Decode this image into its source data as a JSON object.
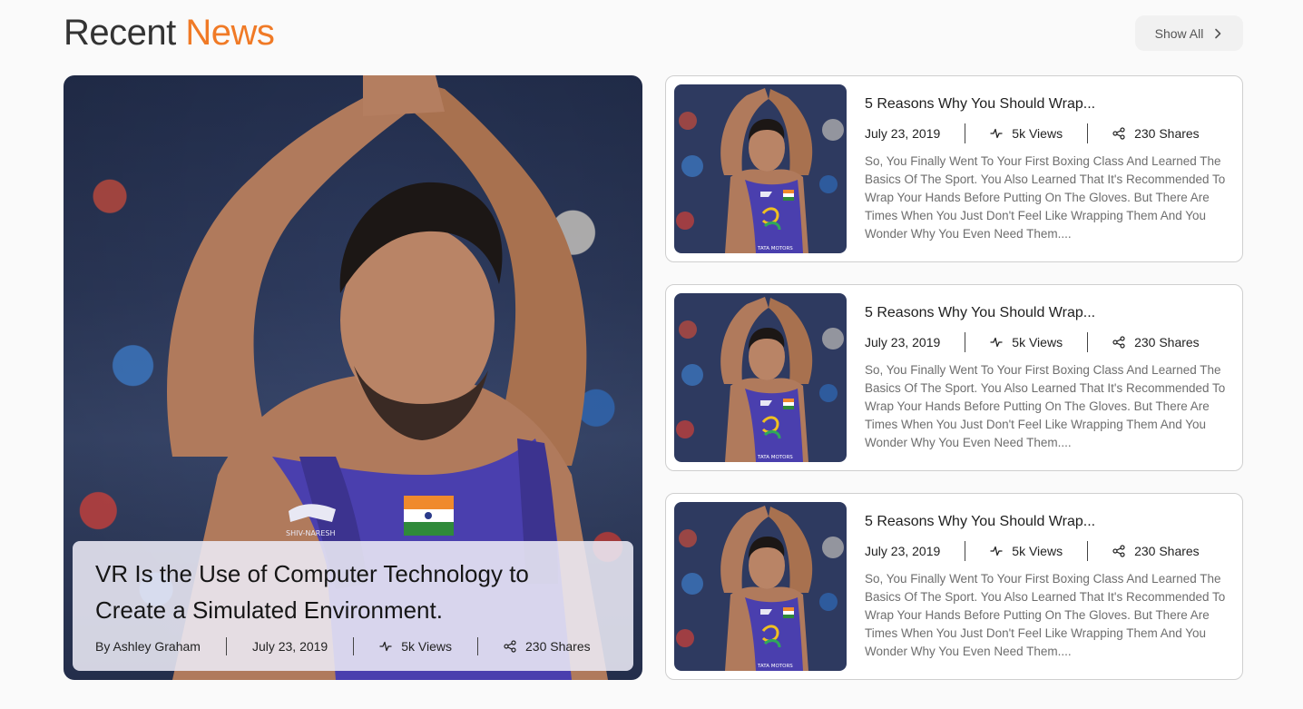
{
  "header": {
    "title_prefix": "Recent",
    "title_accent": "News",
    "accent_color": "#f07a26",
    "show_all_label": "Show All"
  },
  "featured": {
    "title": "VR Is the Use of Computer Technology to Create a Simulated Environment.",
    "author": "By Ashley Graham",
    "date": "July 23, 2019",
    "views": "5k Views",
    "shares": "230 Shares",
    "singlet_text": "SHIV-NARESH"
  },
  "articles": [
    {
      "title": "5 Reasons Why You Should Wrap...",
      "date": "July 23, 2019",
      "views": "5k Views",
      "shares": "230 Shares",
      "excerpt": "So, You Finally Went To Your First Boxing Class And Learned The Basics Of The Sport. You Also Learned That It's Recommended To Wrap Your Hands Before Putting On The Gloves. But There Are Times When You Just Don't Feel Like Wrapping Them And You Wonder Why You Even Need Them....",
      "thumb_caption": "TATA MOTORS"
    },
    {
      "title": "5 Reasons Why You Should Wrap...",
      "date": "July 23, 2019",
      "views": "5k Views",
      "shares": "230 Shares",
      "excerpt": "So, You Finally Went To Your First Boxing Class And Learned The Basics Of The Sport. You Also Learned That It's Recommended To Wrap Your Hands Before Putting On The Gloves. But There Are Times When You Just Don't Feel Like Wrapping Them And You Wonder Why You Even Need Them....",
      "thumb_caption": "TATA MOTORS"
    },
    {
      "title": "5 Reasons Why You Should Wrap...",
      "date": "July 23, 2019",
      "views": "5k Views",
      "shares": "230 Shares",
      "excerpt": "So, You Finally Went To Your First Boxing Class And Learned The Basics Of The Sport. You Also Learned That It's Recommended To Wrap Your Hands Before Putting On The Gloves. But There Are Times When You Just Don't Feel Like Wrapping Them And You Wonder Why You Even Need Them....",
      "thumb_caption": "TATA MOTORS"
    }
  ]
}
